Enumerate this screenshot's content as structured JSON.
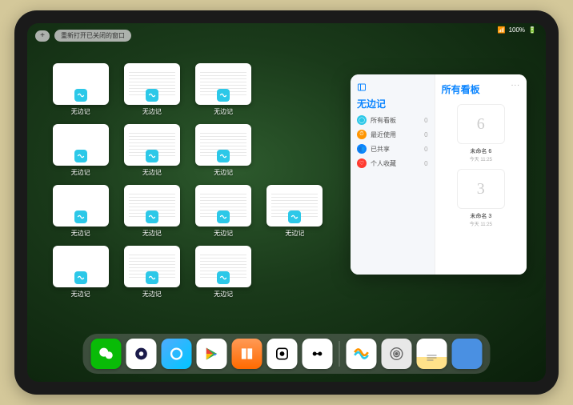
{
  "statusbar": {
    "wifi": "📶",
    "battery": "100%",
    "battery_icon": "🔋"
  },
  "topbar": {
    "plus_label": "+",
    "recent_label": "重新打开已关闭的窗口"
  },
  "grid": {
    "app_label": "无边记",
    "windows": [
      {
        "variant": "plain"
      },
      {
        "variant": "lines"
      },
      {
        "variant": "lines"
      },
      {
        "variant": "plain"
      },
      {
        "variant": "lines"
      },
      {
        "variant": "lines"
      },
      {
        "variant": "plain"
      },
      {
        "variant": "lines"
      },
      {
        "variant": "lines"
      },
      {
        "variant": "lines"
      },
      {
        "variant": "plain"
      },
      {
        "variant": "lines"
      },
      {
        "variant": "lines"
      }
    ]
  },
  "popover": {
    "left_title": "无边记",
    "right_title": "所有看板",
    "categories": [
      {
        "icon_bg": "#2cc8e8",
        "glyph": "◯",
        "label": "所有看板",
        "count": 0
      },
      {
        "icon_bg": "#ff9500",
        "glyph": "⏱",
        "label": "最近使用",
        "count": 0
      },
      {
        "icon_bg": "#0a84ff",
        "glyph": "👥",
        "label": "已共享",
        "count": 0
      },
      {
        "icon_bg": "#ff3b30",
        "glyph": "♡",
        "label": "个人收藏",
        "count": 0
      }
    ],
    "boards": [
      {
        "glyph": "6",
        "label": "未命名 6",
        "sub": "今天 11:25"
      },
      {
        "glyph": "3",
        "label": "未命名 3",
        "sub": "今天 11:25"
      }
    ],
    "more": "..."
  },
  "dock": {
    "apps": [
      {
        "name": "wechat-icon",
        "cls": "di-wechat"
      },
      {
        "name": "quark-icon",
        "cls": "di-quark"
      },
      {
        "name": "browser-icon",
        "cls": "di-browser"
      },
      {
        "name": "play-store-icon",
        "cls": "di-play"
      },
      {
        "name": "books-icon",
        "cls": "di-books"
      },
      {
        "name": "dice-icon",
        "cls": "di-dice"
      },
      {
        "name": "connect-icon",
        "cls": "di-pair"
      },
      {
        "name": "freeform-icon",
        "cls": "di-freeform"
      },
      {
        "name": "settings-icon",
        "cls": "di-settings"
      },
      {
        "name": "notes-icon",
        "cls": "di-notes"
      },
      {
        "name": "app-folder-icon",
        "cls": "di-folder"
      }
    ]
  }
}
